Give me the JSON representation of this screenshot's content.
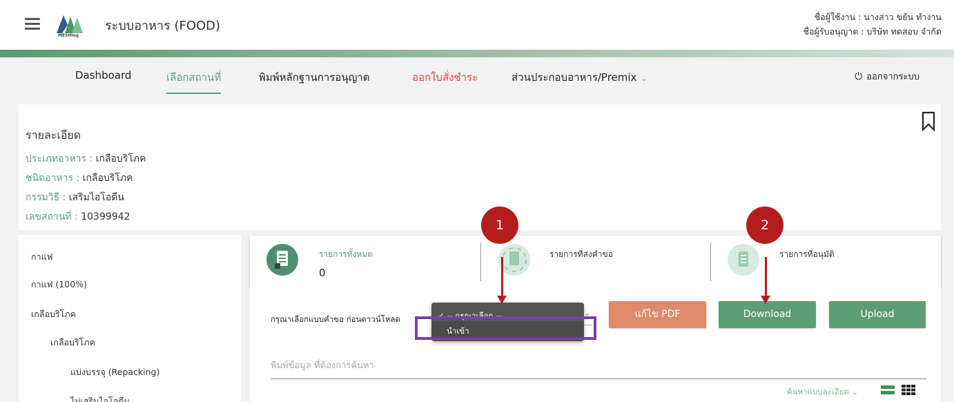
{
  "header": {
    "app_title": "ระบบอาหาร (FOOD)",
    "logo_text": "MESHlog",
    "user_name": "ชื่อผู้ใช้งาน : นางสาว ขยัน ทำงาน",
    "licensee": "ชื่อผู้รับอนุญาต : บริษัท ทดสอบ จำกัด"
  },
  "nav": {
    "items": [
      {
        "label": "Dashboard"
      },
      {
        "label": "เลือกสถานที่"
      },
      {
        "label": "พิมพ์หลักฐานการอนุญาต"
      },
      {
        "label": "ออกใบสั่งชำระ"
      },
      {
        "label": "ส่วนประกอบอาหาร/Premix"
      }
    ],
    "chevron": "⌄",
    "logout_icon": "⏻",
    "logout": "ออกจากระบบ"
  },
  "details": {
    "title": "รายละเอียด",
    "rows": [
      {
        "label": "ประเภทอาหาร : ",
        "value": "เกลือบริโภค"
      },
      {
        "label": "ชนิดอาหาร : ",
        "value": "เกลือบริโภค"
      },
      {
        "label": "กรรมวิธี : ",
        "value": "เสริมไอโอดีน"
      },
      {
        "label": "เลขสถานที่ : ",
        "value": "10399942"
      }
    ]
  },
  "sidebar": {
    "items": [
      {
        "label": "กาแฟ"
      },
      {
        "label": "กาแฟ (100%)"
      },
      {
        "label": "เกลือบริโภค"
      },
      {
        "label": "เกลือบริโภค"
      },
      {
        "label": "แบ่งบรรจุ (Repacking)"
      },
      {
        "label": "ไม่เสริมไอโอดีน"
      }
    ]
  },
  "stats": [
    {
      "label": "รายการทั้งหมด",
      "count": "0"
    },
    {
      "label": "รายการที่ส่งคำขอ",
      "count": ""
    },
    {
      "label": "รายการที่อนุมัติ",
      "count": ""
    }
  ],
  "form": {
    "prompt": "กรุณาเลือกแบบคำขอ ก่อนดาวน์โหลด",
    "dropdown_options": [
      "✓ -- กรุณาเลือก --",
      "นำเข้า"
    ],
    "edit_pdf": "แก้ไข PDF",
    "download": "Download",
    "upload": "Upload",
    "search_placeholder": "พิมพ์ข้อมูล ที่ต้องการค้นหา",
    "advanced_search": "ค้นหาแบบละเอียด ⌄"
  },
  "annotations": {
    "marker_1": "1",
    "marker_2": "2",
    "marker_color": "#b51d1d",
    "highlight_color": "#7b3fa0"
  },
  "colors": {
    "accent_green": "#5aa07a",
    "nav_red": "#e0463a",
    "button_green": "#5c9e72",
    "button_orange": "#e08a6c"
  }
}
